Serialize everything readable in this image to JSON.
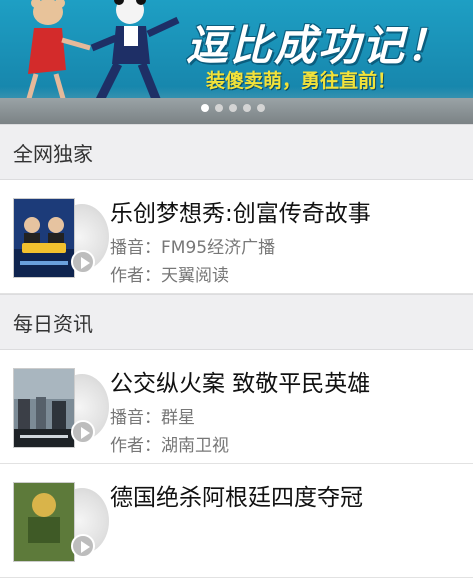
{
  "banner": {
    "title": "逗比成功记！",
    "subtitle": "装傻卖萌，勇往直前！",
    "pagination": {
      "count": 5,
      "active_index": 0
    }
  },
  "sections": [
    {
      "header": "全网独家",
      "items": [
        {
          "title": "乐创梦想秀:创富传奇故事",
          "broadcaster": "播音：FM95经济广播",
          "author": "作者：天翼阅读"
        }
      ]
    },
    {
      "header": "每日资讯",
      "items": [
        {
          "title": "公交纵火案 致敬平民英雄",
          "broadcaster": "播音：群星",
          "author": "作者：湖南卫视"
        },
        {
          "title": "德国绝杀阿根廷四度夺冠",
          "broadcaster": "",
          "author": ""
        }
      ]
    }
  ],
  "colors": {
    "section_header_bg": "#efeff1",
    "banner_bg": "#1787ad",
    "banner_subtitle": "#f2e23a"
  },
  "icons": [
    "play-icon",
    "disc-icon"
  ]
}
